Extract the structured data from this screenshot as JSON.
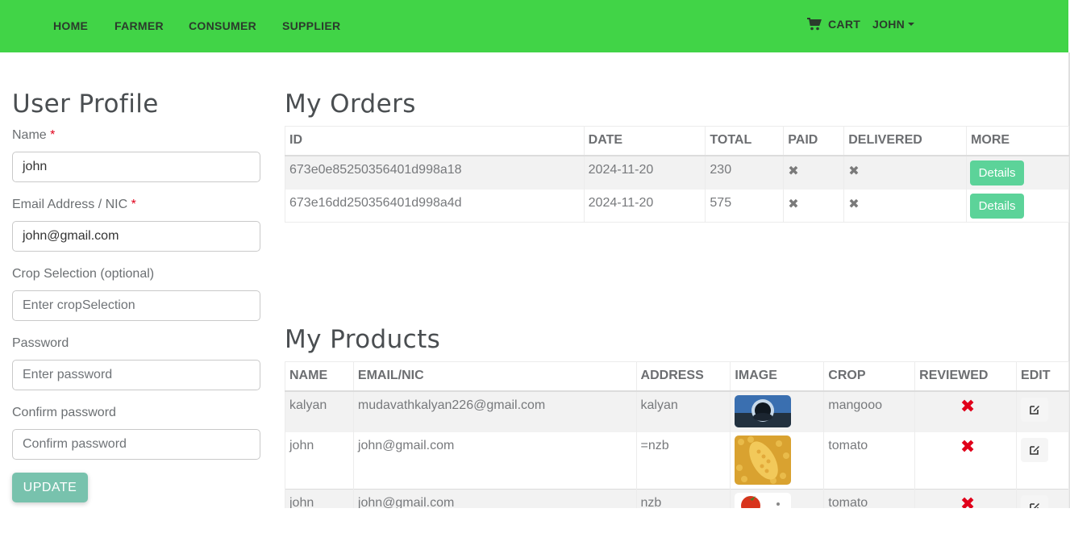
{
  "nav": {
    "home": "HOME",
    "farmer": "FARMER",
    "consumer": "CONSUMER",
    "supplier": "SUPPLIER",
    "cart": "CART",
    "user": "JOHN"
  },
  "profile": {
    "title": "User Profile",
    "name_label": "Name",
    "name_value": "john",
    "email_label": "Email Address / NIC",
    "email_value": "john@gmail.com",
    "crop_label": "Crop Selection (optional)",
    "crop_placeholder": "Enter cropSelection",
    "password_label": "Password",
    "password_placeholder": "Enter password",
    "confirm_label": "Confirm password",
    "confirm_placeholder": "Confirm password",
    "required_mark": "*",
    "update_label": "UPDATE"
  },
  "orders": {
    "title": "My Orders",
    "headers": [
      "ID",
      "DATE",
      "TOTAL",
      "PAID",
      "DELIVERED",
      "MORE"
    ],
    "rows": [
      {
        "id": "673e0e85250356401d998a18",
        "date": "2024-11-20",
        "total": "230",
        "paid": "✖",
        "delivered": "✖",
        "more": "Details"
      },
      {
        "id": "673e16dd250356401d998a4d",
        "date": "2024-11-20",
        "total": "575",
        "paid": "✖",
        "delivered": "✖",
        "more": "Details"
      }
    ]
  },
  "products": {
    "title": "My Products",
    "headers": [
      "NAME",
      "EMAIL/NIC",
      "ADDRESS",
      "IMAGE",
      "CROP",
      "REVIEWED",
      "EDIT"
    ],
    "rows": [
      {
        "name": "kalyan",
        "email": "mudavathkalyan226@gmail.com",
        "address": "kalyan",
        "crop": "mangooo",
        "reviewed": "✖"
      },
      {
        "name": "john",
        "email": "john@gmail.com",
        "address": "=nzb",
        "crop": "tomato",
        "reviewed": "✖"
      },
      {
        "name": "john",
        "email": "john@gmail.com",
        "address": "nzb",
        "crop": "tomato",
        "reviewed": "✖"
      }
    ]
  },
  "colors": {
    "navbar": "#41d447",
    "update_button": "#78c2ad",
    "details_button": "#5cd399",
    "required": "#e0001a"
  },
  "icons": {
    "cart": "cart-icon",
    "edit": "edit-icon",
    "not_paid": "x-icon",
    "not_reviewed": "red-x-icon"
  }
}
